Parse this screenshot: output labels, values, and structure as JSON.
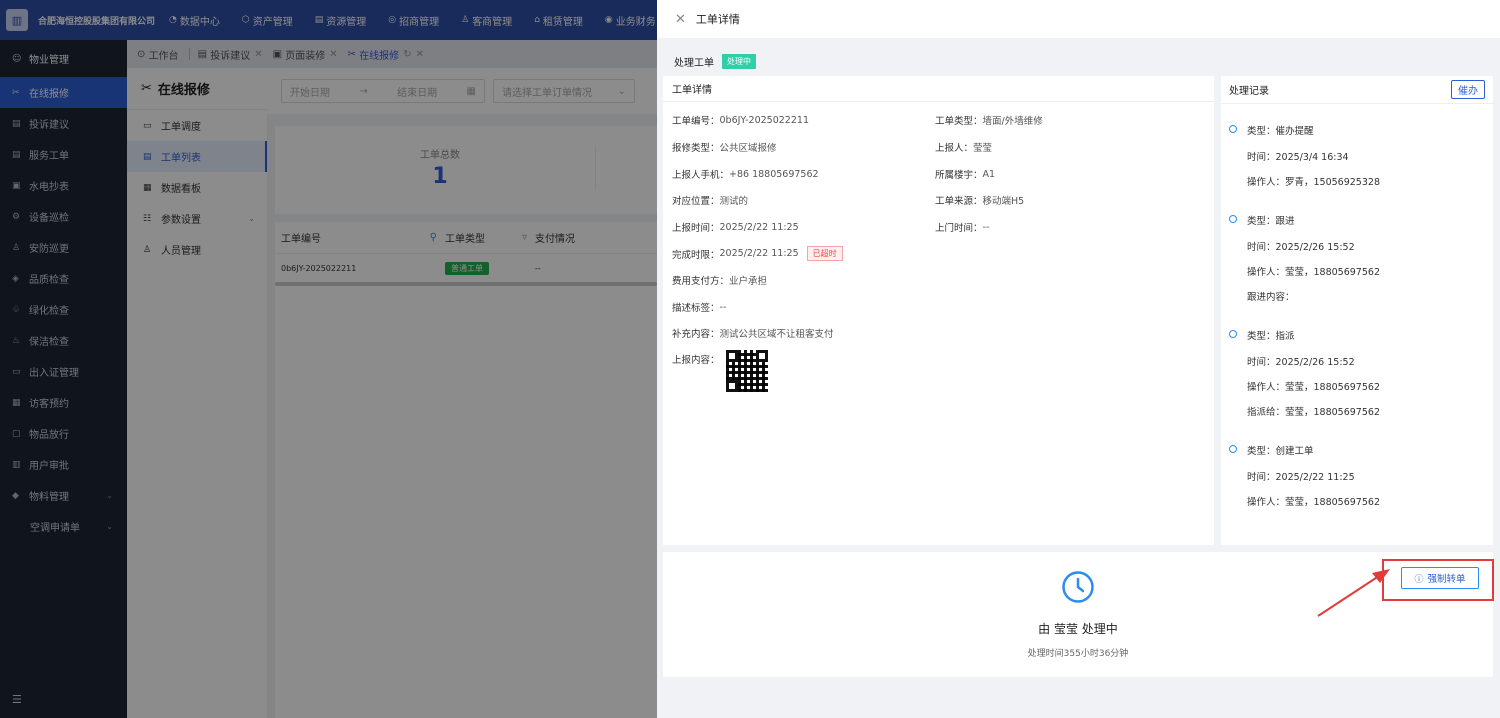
{
  "top": {
    "company": "合肥海恒控股股集团有限公司",
    "nav": [
      {
        "icon": "chart-icon",
        "glyph": "◔",
        "label": "数据中心"
      },
      {
        "icon": "cube-icon",
        "glyph": "⬡",
        "label": "资产管理"
      },
      {
        "icon": "layers-icon",
        "glyph": "▤",
        "label": "资源管理"
      },
      {
        "icon": "target-icon",
        "glyph": "◎",
        "label": "招商管理"
      },
      {
        "icon": "users-icon",
        "glyph": "♙",
        "label": "客商管理"
      },
      {
        "icon": "home-icon",
        "glyph": "⌂",
        "label": "租赁管理"
      },
      {
        "icon": "money-icon",
        "glyph": "◉",
        "label": "业务财务"
      }
    ]
  },
  "sidebar": {
    "header": "物业管理",
    "items": [
      {
        "label": "在线报修",
        "active": true
      },
      {
        "label": "投诉建议"
      },
      {
        "label": "服务工单"
      },
      {
        "label": "水电抄表"
      },
      {
        "label": "设备巡检"
      },
      {
        "label": "安防巡更"
      },
      {
        "label": "品质检查"
      },
      {
        "label": "绿化检查"
      },
      {
        "label": "保洁检查"
      },
      {
        "label": "出入证管理"
      },
      {
        "label": "访客预约"
      },
      {
        "label": "物品放行"
      },
      {
        "label": "用户审批"
      },
      {
        "label": "物料管理"
      },
      {
        "label": "空调申请单"
      }
    ],
    "collapse_glyph": "☰"
  },
  "tabs": [
    {
      "label": "工作台"
    },
    {
      "label": "投诉建议"
    },
    {
      "label": "页面装修"
    },
    {
      "label": "在线报修"
    }
  ],
  "subnav": {
    "title": "在线报修",
    "items": [
      "工单调度",
      "工单列表",
      "数据看板",
      "参数设置",
      "人员管理"
    ]
  },
  "filters": {
    "start_placeholder": "开始日期",
    "end_placeholder": "结束日期",
    "range_sep": "→",
    "select_placeholder": "请选择工单订单情况"
  },
  "stats": {
    "label": "工单总数",
    "value": "1"
  },
  "table": {
    "headers": [
      "工单编号",
      "工单类型",
      "支付情况"
    ],
    "row": {
      "id": "0b6JY-2025022211",
      "type": "普通工单",
      "pay": "--"
    }
  },
  "drawer": {
    "title": "工单详情",
    "status_label": "处理工单",
    "status_tag": "处理中",
    "detail_title": "工单详情",
    "fields": {
      "order_no": {
        "k": "工单编号：",
        "v": "0b6JY-2025022211"
      },
      "order_type": {
        "k": "工单类型：",
        "v": "墙面/外墙维修"
      },
      "repair_type": {
        "k": "报修类型：",
        "v": "公共区域报修"
      },
      "reporter": {
        "k": "上报人：",
        "v": "莹莹"
      },
      "phone": {
        "k": "上报人手机：",
        "v": "+86 18805697562"
      },
      "building": {
        "k": "所属楼宇：",
        "v": "A1"
      },
      "location": {
        "k": "对应位置：",
        "v": "测试的"
      },
      "source": {
        "k": "工单来源：",
        "v": "移动端H5"
      },
      "report_time": {
        "k": "上报时间：",
        "v": "2025/2/22 11:25"
      },
      "visit_time": {
        "k": "上门时间：",
        "v": "--"
      },
      "deadline": {
        "k": "完成时限：",
        "v": "2025/2/22 11:25",
        "tag": "已超时"
      },
      "payer": {
        "k": "费用支付方：",
        "v": "业户承担"
      },
      "desc_tag": {
        "k": "描述标签：",
        "v": "--"
      },
      "extra": {
        "k": "补充内容：",
        "v": "测试公共区域不让租客支付"
      },
      "content": {
        "k": "上报内容：",
        "v": ""
      }
    },
    "records_title": "处理记录",
    "urge_btn": "催办",
    "records": [
      {
        "type": "类型：催办提醒",
        "lines": [
          "时间：2025/3/4 16:34",
          "操作人：罗青，15056925328"
        ]
      },
      {
        "type": "类型：跟进",
        "lines": [
          "时间：2025/2/26 15:52",
          "操作人：莹莹，18805697562",
          "跟进内容："
        ]
      },
      {
        "type": "类型：指派",
        "lines": [
          "时间：2025/2/26 15:52",
          "操作人：莹莹，18805697562",
          "指派给：莹莹，18805697562"
        ]
      },
      {
        "type": "类型：创建工单",
        "lines": [
          "时间：2025/2/22 11:25",
          "操作人：莹莹，18805697562"
        ]
      }
    ],
    "handler_text": "由 莹莹 处理中",
    "duration_text": "处理时间355小时36分钟",
    "force_btn": "强制转单"
  },
  "colors": {
    "primary": "#2d5fd6",
    "topbar": "#2e4fa6",
    "sidebar": "#1d2636",
    "success": "#23b14d",
    "status_tag": "#2fd0a9",
    "danger": "#e23b3b"
  }
}
